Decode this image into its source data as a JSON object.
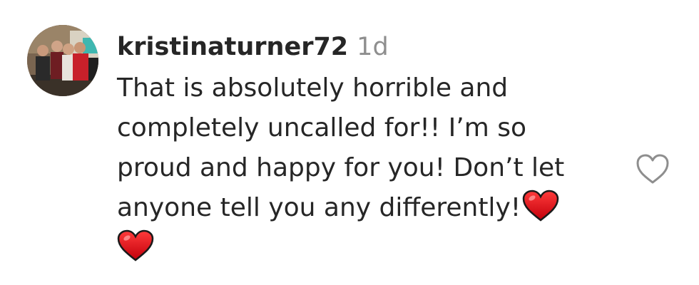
{
  "comment": {
    "username": "kristinaturner72",
    "timestamp": "1d",
    "text_lines": [
      "That is absolutely horrible and",
      "completely uncalled for!! I’m so",
      "proud and happy for you! Don’t let",
      "anyone tell you any differently!"
    ],
    "emojis": [
      "red-heart",
      "red-heart"
    ],
    "like_icon": "heart-outline-icon"
  },
  "colors": {
    "text": "#262626",
    "timestamp": "#8e8e8e",
    "heart_red": "#e0141e",
    "like_outline": "#8e8e8e"
  }
}
